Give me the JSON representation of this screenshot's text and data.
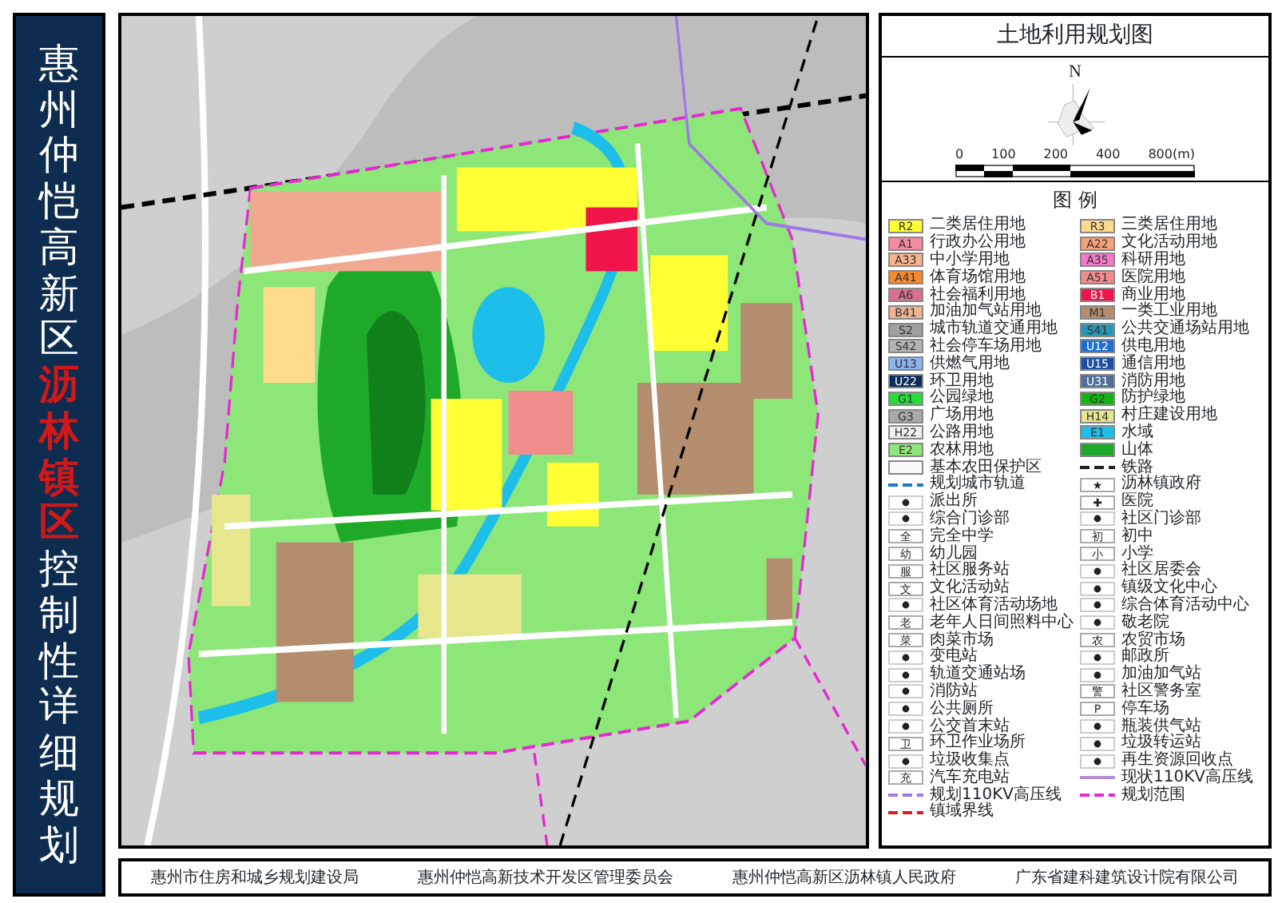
{
  "title_parts": [
    {
      "text": "惠州仲恺高新区",
      "highlight": false
    },
    {
      "text": "沥林镇区",
      "highlight": true
    },
    {
      "text": "控制性详细规划",
      "highlight": false
    }
  ],
  "panel": {
    "title": "土地利用规划图",
    "north": "N",
    "scale_labels": [
      "0",
      "100",
      "200",
      "400",
      "800(m)"
    ],
    "legend_title": "图 例"
  },
  "legend": [
    {
      "kind": "code",
      "code": "R2",
      "color": "#ffff33",
      "label": "二类居住用地"
    },
    {
      "kind": "code",
      "code": "R3",
      "color": "#ffd98c",
      "label": "三类居住用地"
    },
    {
      "kind": "code",
      "code": "A1",
      "color": "#f58ca0",
      "label": "行政办公用地"
    },
    {
      "kind": "code",
      "code": "A22",
      "color": "#f7a37a",
      "label": "文化活动用地"
    },
    {
      "kind": "code",
      "code": "A33",
      "color": "#f7b48c",
      "label": "中小学用地"
    },
    {
      "kind": "code",
      "code": "A35",
      "color": "#f27ac8",
      "label": "科研用地"
    },
    {
      "kind": "code",
      "code": "A41",
      "color": "#f7892f",
      "label": "体育场馆用地"
    },
    {
      "kind": "code",
      "code": "A51",
      "color": "#f08c8c",
      "label": "医院用地"
    },
    {
      "kind": "code",
      "code": "A6",
      "color": "#d9708c",
      "label": "社会福利用地"
    },
    {
      "kind": "code",
      "code": "B1",
      "color": "#f0144b",
      "label": "商业用地"
    },
    {
      "kind": "code",
      "code": "B41",
      "color": "#f0b490",
      "label": "加油加气站用地"
    },
    {
      "kind": "code",
      "code": "M1",
      "color": "#b48c6e",
      "label": "一类工业用地"
    },
    {
      "kind": "code",
      "code": "S2",
      "color": "#a0a0a0",
      "label": "城市轨道交通用地"
    },
    {
      "kind": "code",
      "code": "S41",
      "color": "#2896b4",
      "label": "公共交通场站用地"
    },
    {
      "kind": "code",
      "code": "S42",
      "color": "#b4b4b4",
      "label": "社会停车场用地"
    },
    {
      "kind": "code",
      "code": "U12",
      "color": "#1e6ed2",
      "label": "供电用地"
    },
    {
      "kind": "code",
      "code": "U13",
      "color": "#8cb4f0",
      "label": "供燃气用地"
    },
    {
      "kind": "code",
      "code": "U15",
      "color": "#1e50a0",
      "label": "通信用地"
    },
    {
      "kind": "code",
      "code": "U22",
      "color": "#0a2d5a",
      "label": "环卫用地"
    },
    {
      "kind": "code",
      "code": "U31",
      "color": "#506e96",
      "label": "消防用地"
    },
    {
      "kind": "code",
      "code": "G1",
      "color": "#28dc3c",
      "label": "公园绿地"
    },
    {
      "kind": "code",
      "code": "G2",
      "color": "#14b414",
      "label": "防护绿地"
    },
    {
      "kind": "code",
      "code": "G3",
      "color": "#a8a8a8",
      "label": "广场用地"
    },
    {
      "kind": "code",
      "code": "H14",
      "color": "#e6e68c",
      "label": "村庄建设用地"
    },
    {
      "kind": "code",
      "code": "H22",
      "color": "#f0f0f0",
      "label": "公路用地"
    },
    {
      "kind": "code",
      "code": "E1",
      "color": "#1ebeeb",
      "label": "水域"
    },
    {
      "kind": "code",
      "code": "E2",
      "color": "#8ce678",
      "label": "农林用地"
    },
    {
      "kind": "swatch",
      "color": "#1eaa28",
      "label": "山体"
    },
    {
      "kind": "swatch",
      "color": "#f8f8f8",
      "label": "基本农田保护区"
    },
    {
      "kind": "line",
      "color": "#222222",
      "dashed": true,
      "label": "铁路"
    },
    {
      "kind": "line",
      "color": "#1e78c8",
      "dashed": true,
      "label": "规划城市轨道"
    },
    {
      "kind": "symbol",
      "symbol": "★",
      "label": "沥林镇政府"
    },
    {
      "kind": "icon",
      "label": "派出所"
    },
    {
      "kind": "symbol",
      "symbol": "✚",
      "label": "医院"
    },
    {
      "kind": "icon",
      "label": "综合门诊部"
    },
    {
      "kind": "icon",
      "label": "社区门诊部"
    },
    {
      "kind": "symbol",
      "symbol": "全",
      "label": "完全中学"
    },
    {
      "kind": "symbol",
      "symbol": "初",
      "label": "初中"
    },
    {
      "kind": "symbol",
      "symbol": "幼",
      "label": "幼儿园"
    },
    {
      "kind": "symbol",
      "symbol": "小",
      "label": "小学"
    },
    {
      "kind": "symbol",
      "symbol": "服",
      "label": "社区服务站"
    },
    {
      "kind": "icon",
      "label": "社区居委会"
    },
    {
      "kind": "symbol",
      "symbol": "文",
      "label": "文化活动站"
    },
    {
      "kind": "icon",
      "label": "镇级文化中心"
    },
    {
      "kind": "icon",
      "label": "社区体育活动场地"
    },
    {
      "kind": "icon",
      "label": "综合体育活动中心"
    },
    {
      "kind": "symbol",
      "symbol": "老",
      "label": "老年人日间照料中心"
    },
    {
      "kind": "icon",
      "label": "敬老院"
    },
    {
      "kind": "symbol",
      "symbol": "菜",
      "label": "肉菜市场"
    },
    {
      "kind": "symbol",
      "symbol": "农",
      "label": "农贸市场"
    },
    {
      "kind": "icon",
      "label": "变电站"
    },
    {
      "kind": "icon",
      "label": "邮政所"
    },
    {
      "kind": "icon",
      "label": "轨道交通站场"
    },
    {
      "kind": "icon",
      "label": "加油加气站"
    },
    {
      "kind": "icon",
      "label": "消防站"
    },
    {
      "kind": "symbol",
      "symbol": "警",
      "label": "社区警务室"
    },
    {
      "kind": "icon",
      "label": "公共厕所"
    },
    {
      "kind": "symbol",
      "symbol": "P",
      "label": "停车场"
    },
    {
      "kind": "icon",
      "label": "公交首末站"
    },
    {
      "kind": "icon",
      "label": "瓶装供气站"
    },
    {
      "kind": "symbol",
      "symbol": "卫",
      "label": "环卫作业场所"
    },
    {
      "kind": "icon",
      "label": "垃圾转运站"
    },
    {
      "kind": "icon",
      "label": "垃圾收集点"
    },
    {
      "kind": "icon",
      "label": "再生资源回收点"
    },
    {
      "kind": "symbol",
      "symbol": "充",
      "label": "汽车充电站"
    },
    {
      "kind": "line",
      "color": "#b48cdc",
      "dashed": false,
      "label": "现状110KV高压线"
    },
    {
      "kind": "line",
      "color": "#a078e6",
      "dashed": true,
      "label": "规划110KV高压线"
    },
    {
      "kind": "line",
      "color": "#e628d2",
      "dashed": true,
      "label": "规划范围"
    },
    {
      "kind": "line",
      "color": "#dc1e1e",
      "dashed": true,
      "label": "镇域界线"
    }
  ],
  "footer": [
    "惠州市住房和城乡规划建设局",
    "惠州仲恺高新技术开发区管理委员会",
    "惠州仲恺高新区沥林镇人民政府",
    "广东省建科建筑设计院有限公司"
  ]
}
